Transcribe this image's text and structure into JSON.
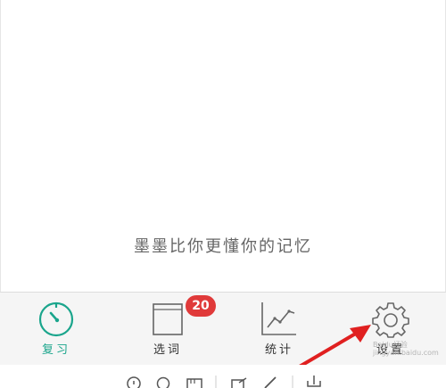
{
  "main": {
    "slogan": "墨墨比你更懂你的记忆"
  },
  "tabs": [
    {
      "label": "复习",
      "icon": "timer-icon",
      "active": true
    },
    {
      "label": "选词",
      "icon": "book-icon",
      "badge": "20"
    },
    {
      "label": "统计",
      "icon": "line-chart-icon"
    },
    {
      "label": "设置",
      "icon": "gear-icon"
    }
  ],
  "colors": {
    "accent": "#1aa58c",
    "badge": "#e03a3a",
    "arrow": "#e02020"
  },
  "watermark": {
    "brand": "Baidu经验",
    "url": "jingyan.baidu.com"
  }
}
